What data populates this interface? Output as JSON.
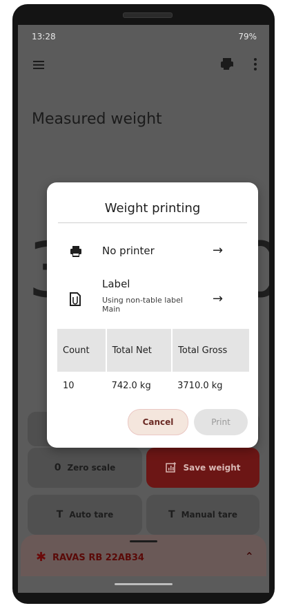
{
  "status_bar": {
    "time": "13:28",
    "battery": "79%"
  },
  "header": {
    "title": "Measured weight"
  },
  "background_digits": {
    "left": "3",
    "right": "0"
  },
  "actions": {
    "zero_scale": "Zero scale",
    "zero_glyph": "0",
    "save_weight": "Save weight",
    "auto_tare": "Auto tare",
    "manual_tare": "Manual tare",
    "tare_glyph": "T"
  },
  "device": {
    "name": "RAVAS RB 22AB34"
  },
  "dialog": {
    "title": "Weight printing",
    "printer_label": "No printer",
    "label_title": "Label",
    "label_subtitle": "Using non-table label Main",
    "table": {
      "headers": [
        "Count",
        "Total Net",
        "Total Gross"
      ],
      "rows": [
        [
          "10",
          "742.0 kg",
          "3710.0 kg"
        ]
      ]
    },
    "cancel": "Cancel",
    "print": "Print"
  },
  "colors": {
    "save_button": "#6c1615",
    "device_panel": "#6a5957",
    "accent": "#6b2a24"
  }
}
